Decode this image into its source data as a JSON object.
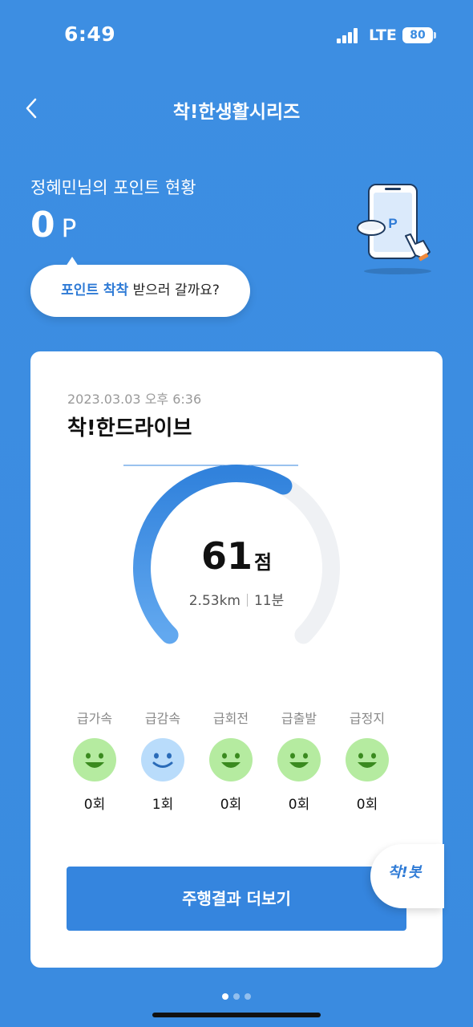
{
  "status_bar": {
    "time": "6:49",
    "network": "LTE",
    "battery": "80"
  },
  "header": {
    "title": "착!한생활시리즈",
    "back_icon": "chevron-left-icon"
  },
  "points": {
    "heading": "정혜민님의 포인트 현황",
    "value": "0",
    "unit": "P",
    "bubble_highlight": "포인트 착착",
    "bubble_rest": " 받으러 갈까요?",
    "illustration_letter": "P"
  },
  "card": {
    "date": "2023.03.03 오후 6:36",
    "title": "착!한드라이브",
    "score": {
      "value": "61",
      "unit": "점",
      "max": 100
    },
    "distance": "2.53km",
    "duration": "11분",
    "metrics": [
      {
        "label": "급가속",
        "count": "0회",
        "face": "green-smile"
      },
      {
        "label": "급감속",
        "count": "1회",
        "face": "blue-smile"
      },
      {
        "label": "급회전",
        "count": "0회",
        "face": "green-smile"
      },
      {
        "label": "급출발",
        "count": "0회",
        "face": "green-smile"
      },
      {
        "label": "급정지",
        "count": "0회",
        "face": "green-smile"
      }
    ],
    "button_label": "주행결과 더보기"
  },
  "chatbot_label": "착!봇",
  "pager": {
    "current": 1,
    "total": 3
  },
  "colors": {
    "background": "#3b8ce1",
    "accent": "#3585de",
    "face_green": "#b5eba0",
    "face_blue": "#b9dcfb"
  }
}
